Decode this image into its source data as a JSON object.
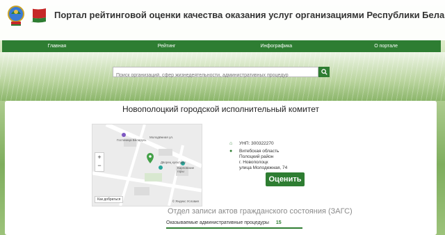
{
  "header": {
    "title": "Портал рейтинговой оценки качества оказания услуг организациями Республики Беларусь",
    "emblem_icon": "belarus-emblem-icon",
    "flag_icon": "belarus-flag-icon"
  },
  "nav": {
    "items": [
      {
        "label": "Главная"
      },
      {
        "label": "Рейтинг"
      },
      {
        "label": "Инфографика"
      },
      {
        "label": "О портале"
      }
    ]
  },
  "search": {
    "placeholder": "Поиск организаций, сфер жизнедеятельности, административных процедур",
    "button_icon": "search-icon"
  },
  "organization": {
    "name": "Новополоцкий городской исполнительный комитет",
    "unp": "УНП: 300322270",
    "address_lines": [
      "Витебская область",
      "Полоцкий район",
      "г. Новополоцк",
      "улица Молодежная, 74"
    ],
    "rate_label": "Оценить"
  },
  "map": {
    "zoom_in": "+",
    "zoom_out": "−",
    "route_label": "Как добраться",
    "copyright": "© Яндекс Условия",
    "labels": [
      "Молодёжная ул.",
      "Гостиница Беларусь",
      "Дворец культуры",
      "Карповские горы"
    ]
  },
  "department": {
    "name": "Отдел записи актов гражданского состояния (ЗАГС)",
    "services_label": "Оказываемые административные процедуры",
    "services_count": "15"
  },
  "colors": {
    "accent": "#2e7d32",
    "nav_bg": "#2e7d32",
    "title_text": "#333333"
  }
}
